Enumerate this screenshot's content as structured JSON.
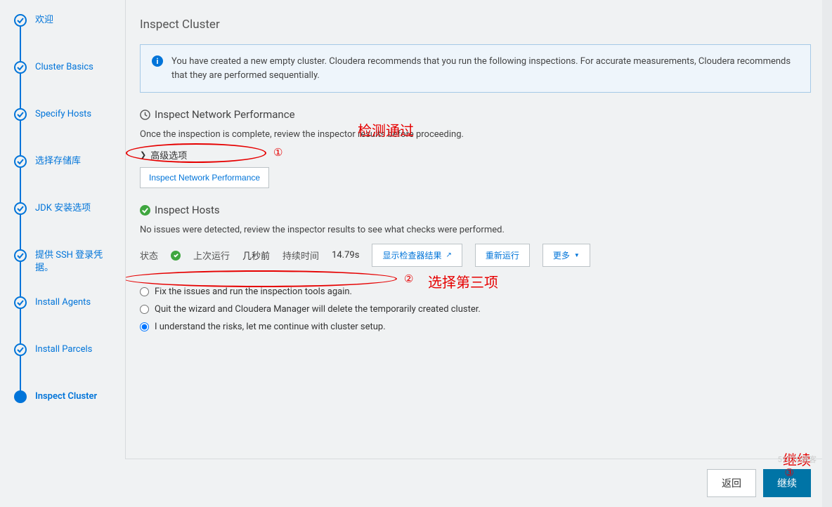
{
  "sidebar": {
    "steps": [
      {
        "label": "欢迎",
        "done": true
      },
      {
        "label": "Cluster Basics",
        "done": true
      },
      {
        "label": "Specify Hosts",
        "done": true
      },
      {
        "label": "选择存储库",
        "done": true
      },
      {
        "label": "JDK 安装选项",
        "done": true
      },
      {
        "label": "提供 SSH 登录凭据。",
        "done": true
      },
      {
        "label": "Install Agents",
        "done": true
      },
      {
        "label": "Install Parcels",
        "done": true
      },
      {
        "label": "Inspect Cluster",
        "current": true
      }
    ]
  },
  "page": {
    "title": "Inspect Cluster",
    "info_text": "You have created a new empty cluster. Cloudera recommends that you run the following inspections. For accurate measurements, Cloudera recommends that they are performed sequentially.",
    "network": {
      "heading": "Inspect Network Performance",
      "desc": "Once the inspection is complete, review the inspector results before proceeding.",
      "advanced": "高级选项",
      "button": "Inspect Network Performance"
    },
    "hosts": {
      "heading": "Inspect Hosts",
      "desc": "No issues were detected, review the inspector results to see what checks were performed.",
      "status_label": "状态",
      "last_run_label": "上次运行",
      "last_run_value": "几秒前",
      "duration_label": "持续时间",
      "duration_value": "14.79s",
      "show_results": "显示检查器结果",
      "rerun": "重新运行",
      "more": "更多"
    },
    "radios": {
      "fix": "Fix the issues and run the inspection tools again.",
      "quit": "Quit the wizard and Cloudera Manager will delete the temporarily created cluster.",
      "understand": "I understand the risks, let me continue with cluster setup."
    },
    "footer": {
      "back": "返回",
      "continue": "继续"
    }
  },
  "annotations": {
    "pass": "检测通过",
    "select_third": "选择第三项",
    "continue_label": "继续",
    "n1": "①",
    "n2": "②",
    "n3": "③"
  },
  "watermark": "51CTO博客"
}
